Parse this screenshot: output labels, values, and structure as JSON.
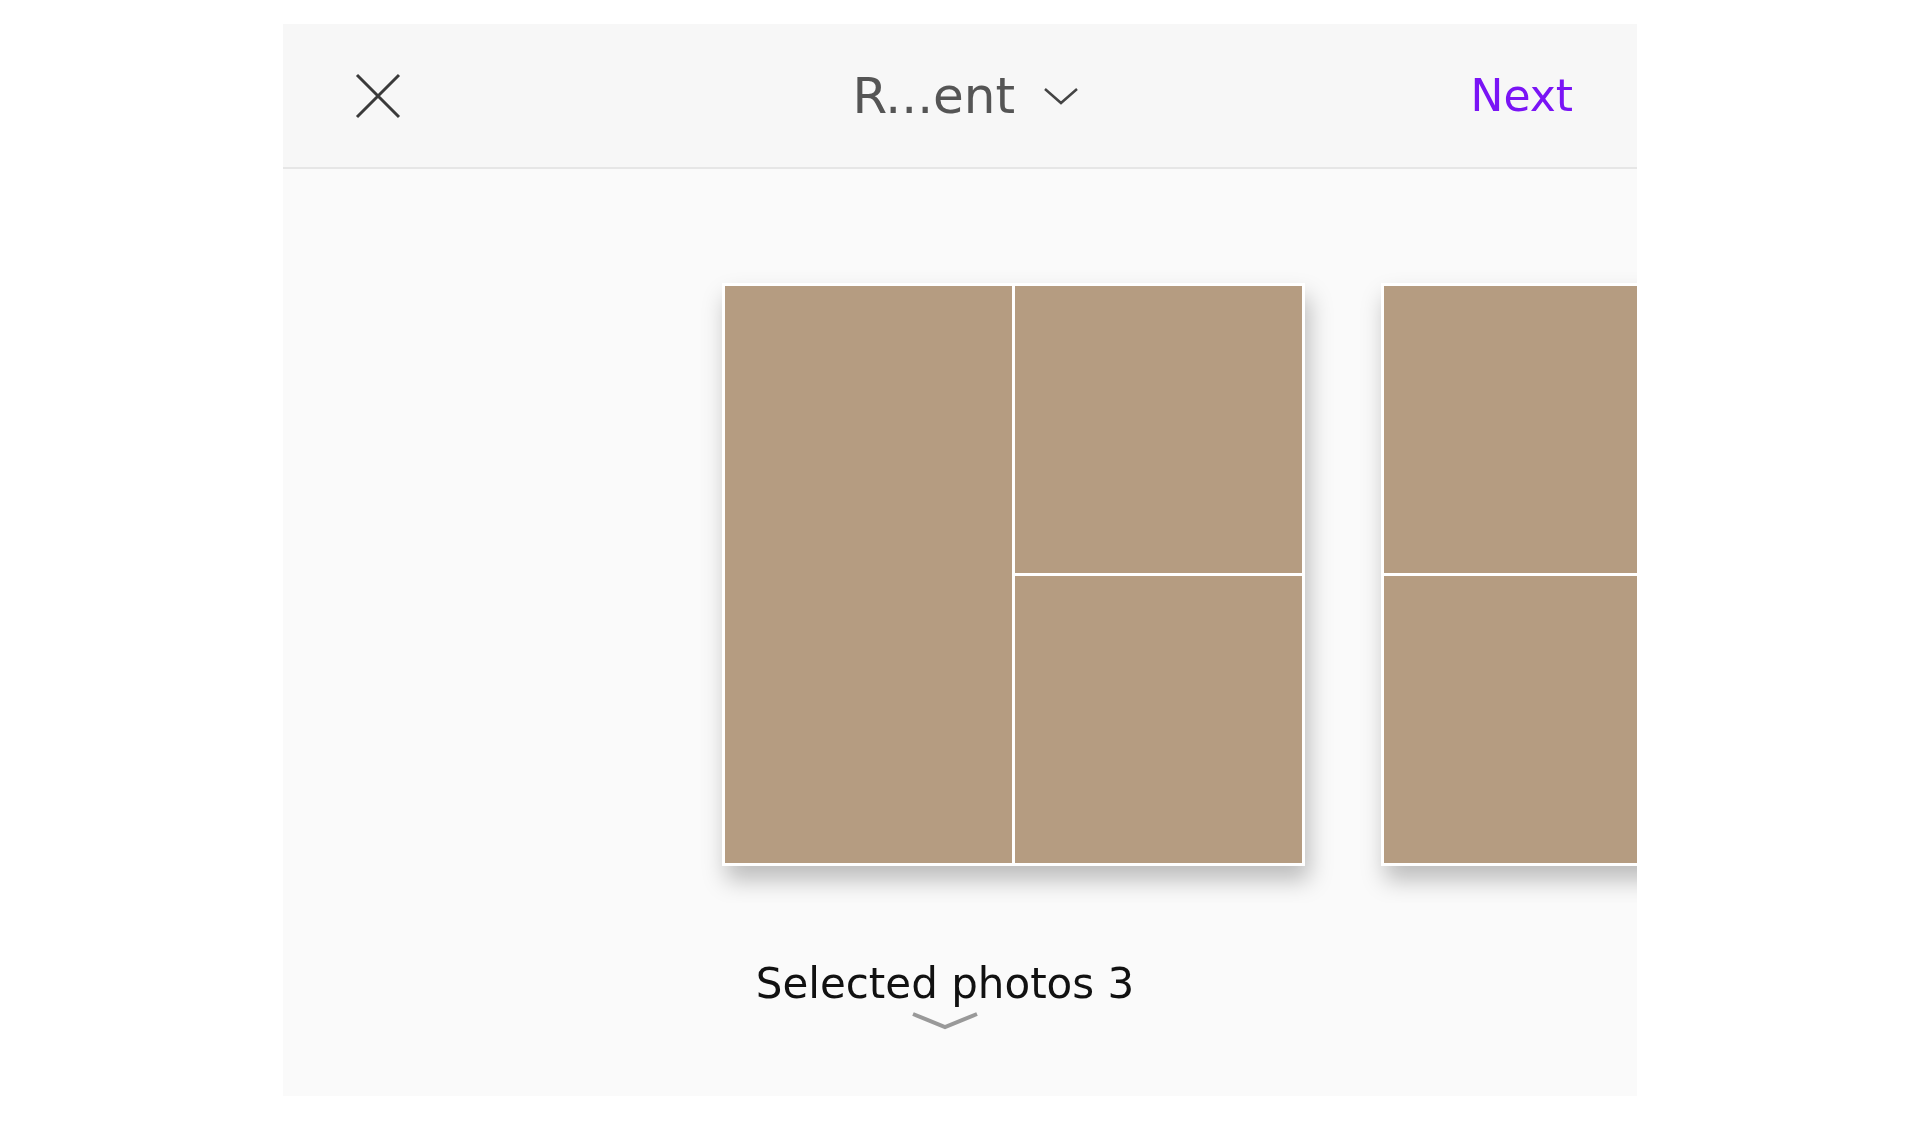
{
  "header": {
    "album_title": "R...ent",
    "next": "Next"
  },
  "layouts": [
    {
      "kind": "one-left-two-right"
    },
    {
      "kind": "two-stacked"
    }
  ],
  "footer": {
    "selected_label": "Selected photos 3"
  }
}
